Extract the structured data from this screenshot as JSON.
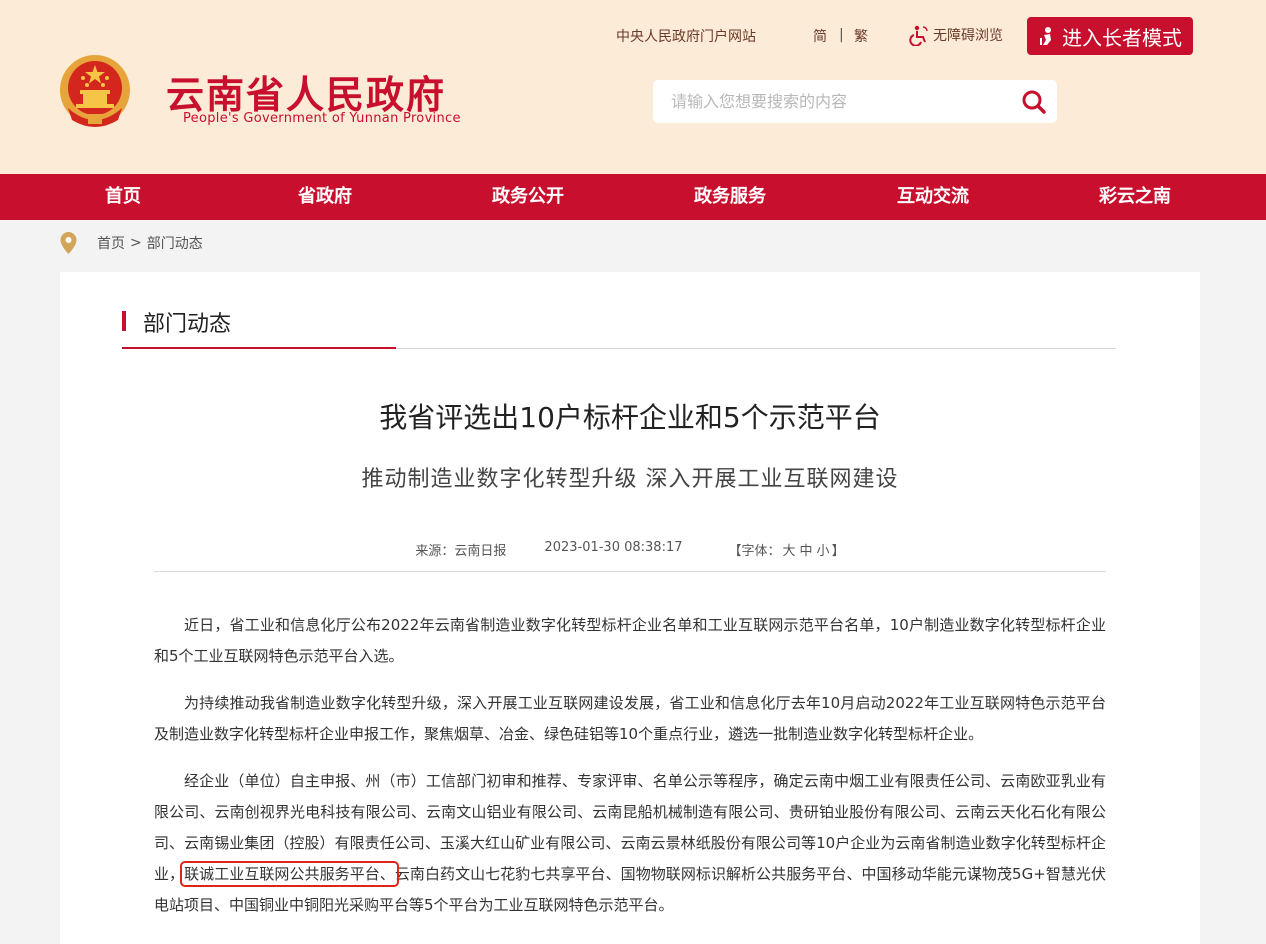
{
  "header": {
    "title": "云南省人民政府",
    "subtitle": "People's Government of Yunnan Province",
    "portal_link": "中央人民政府门户网站",
    "lang_simplified": "简",
    "lang_sep": "|",
    "lang_traditional": "繁",
    "accessibility": "无障碍浏览",
    "elder_mode": "进入长者模式",
    "search_placeholder": "请输入您想要搜索的内容"
  },
  "nav": {
    "items": [
      "首页",
      "省政府",
      "政务公开",
      "政务服务",
      "互动交流",
      "彩云之南"
    ]
  },
  "breadcrumb": {
    "home": "首页",
    "sep": ">",
    "current": "部门动态"
  },
  "section": {
    "title": "部门动态"
  },
  "article": {
    "title": "我省评选出10户标杆企业和5个示范平台",
    "subtitle": "推动制造业数字化转型升级  深入开展工业互联网建设",
    "source": "来源：云南日报",
    "date": "2023-01-30 08:38:17",
    "font_prefix": "【字体：",
    "font_large": "大",
    "font_medium": "中",
    "font_small": "小",
    "font_suffix": "】",
    "p1": "近日，省工业和信息化厅公布2022年云南省制造业数字化转型标杆企业名单和工业互联网示范平台名单，10户制造业数字化转型标杆企业和5个工业互联网特色示范平台入选。",
    "p2": "为持续推动我省制造业数字化转型升级，深入开展工业互联网建设发展，省工业和信息化厅去年10月启动2022年工业互联网特色示范平台及制造业数字化转型标杆企业申报工作，聚焦烟草、冶金、绿色硅铝等10个重点行业，遴选一批制造业数字化转型标杆企业。",
    "p3_before": "经企业（单位）自主申报、州（市）工信部门初审和推荐、专家评审、名单公示等程序，确定云南中烟工业有限责任公司、云南欧亚乳业有限公司、云南创视界光电科技有限公司、云南文山铝业有限公司、云南昆船机械制造有限公司、贵研铂业股份有限公司、云南云天化石化有限公司、云南锡业集团（控股）有限责任公司、玉溪大红山矿业有限公司、云南云景林纸股份有限公司等10户企业为云南省制造业数字化转型标杆企业，",
    "p3_highlight": "联诚工业互联网公共服务平台、",
    "p3_after": "云南白药文山七花豹七共享平台、国物物联网标识解析公共服务平台、中国移动华能元谋物茂5G+智慧光伏电站项目、中国铜业中铜阳光采购平台等5个平台为工业互联网特色示范平台。"
  },
  "colors": {
    "brand_red": "#c8102e",
    "header_bg": "#fcebd7",
    "highlight_border": "#e0241b"
  }
}
